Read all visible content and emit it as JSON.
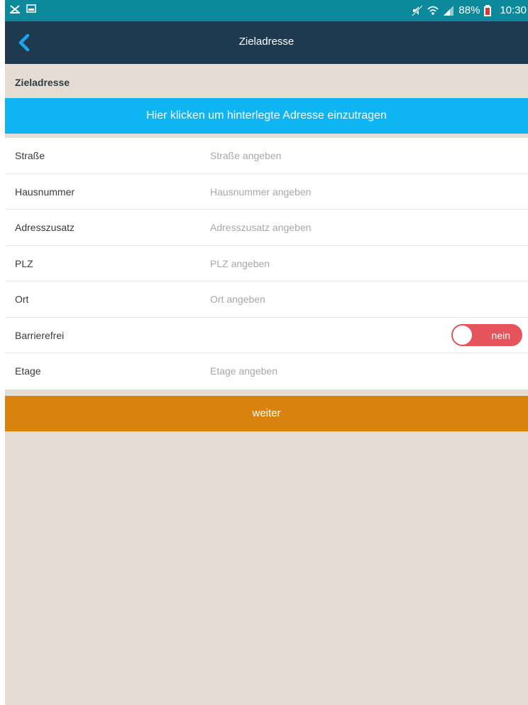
{
  "status_bar": {
    "battery": "88%",
    "time": "10:30",
    "icons": [
      "notification-x-icon",
      "gallery-icon",
      "mute-icon",
      "wifi-icon",
      "signal-icon",
      "battery-icon"
    ]
  },
  "nav": {
    "title": "Zieladresse",
    "back_icon": "chevron-left-icon"
  },
  "section": {
    "title": "Zieladresse"
  },
  "fill_banner": {
    "label": "Hier klicken um hinterlegte Adresse einzutragen"
  },
  "form": {
    "street": {
      "label": "Straße",
      "placeholder": "Straße angeben"
    },
    "house_number": {
      "label": "Hausnummer",
      "placeholder": "Hausnummer angeben"
    },
    "address_extra": {
      "label": "Adresszusatz",
      "placeholder": "Adresszusatz angeben"
    },
    "zip": {
      "label": "PLZ",
      "placeholder": "PLZ angeben"
    },
    "city": {
      "label": "Ort",
      "placeholder": "Ort angeben"
    },
    "barrier_free": {
      "label": "Barrierefrei",
      "toggle_label": "nein",
      "value": false
    },
    "floor": {
      "label": "Etage",
      "placeholder": "Etage angeben"
    }
  },
  "next_button": {
    "label": "weiter"
  },
  "colors": {
    "status_bar": "#0c8a9c",
    "nav_bar": "#1f3a4f",
    "banner": "#0fb4f2",
    "toggle_off": "#e5545b",
    "next_button": "#d9820e",
    "background": "#e5ddd3"
  }
}
